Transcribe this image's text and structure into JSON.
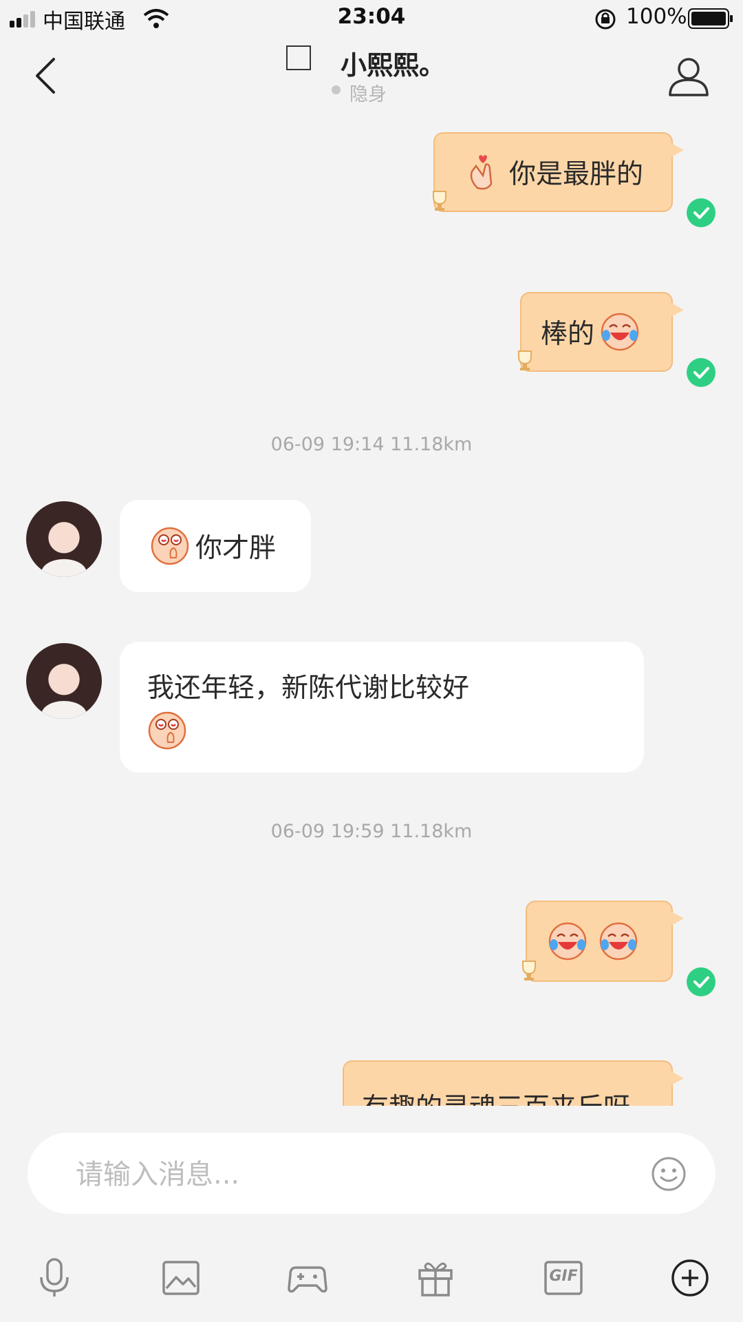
{
  "status_bar": {
    "carrier": "中国联通",
    "time": "23:04",
    "battery": "100%"
  },
  "header": {
    "title": "小熙熙。",
    "presence": "隐身"
  },
  "messages": {
    "m1": "你是最胖的",
    "m2": "棒的",
    "ts1": "06-09 19:14  11.18km",
    "m3": "你才胖",
    "m4": "我还年轻，新陈代谢比较好",
    "ts2": "06-09 19:59  11.18km",
    "m6": "有趣的灵魂三百来斤呀"
  },
  "input": {
    "placeholder": "请输入消息..."
  },
  "toolbar": {
    "gif_label": "GIF"
  },
  "colors": {
    "outgoing_bubble": "#fdd6a8",
    "read_check": "#2ecf83",
    "background": "#f3f3f3"
  }
}
